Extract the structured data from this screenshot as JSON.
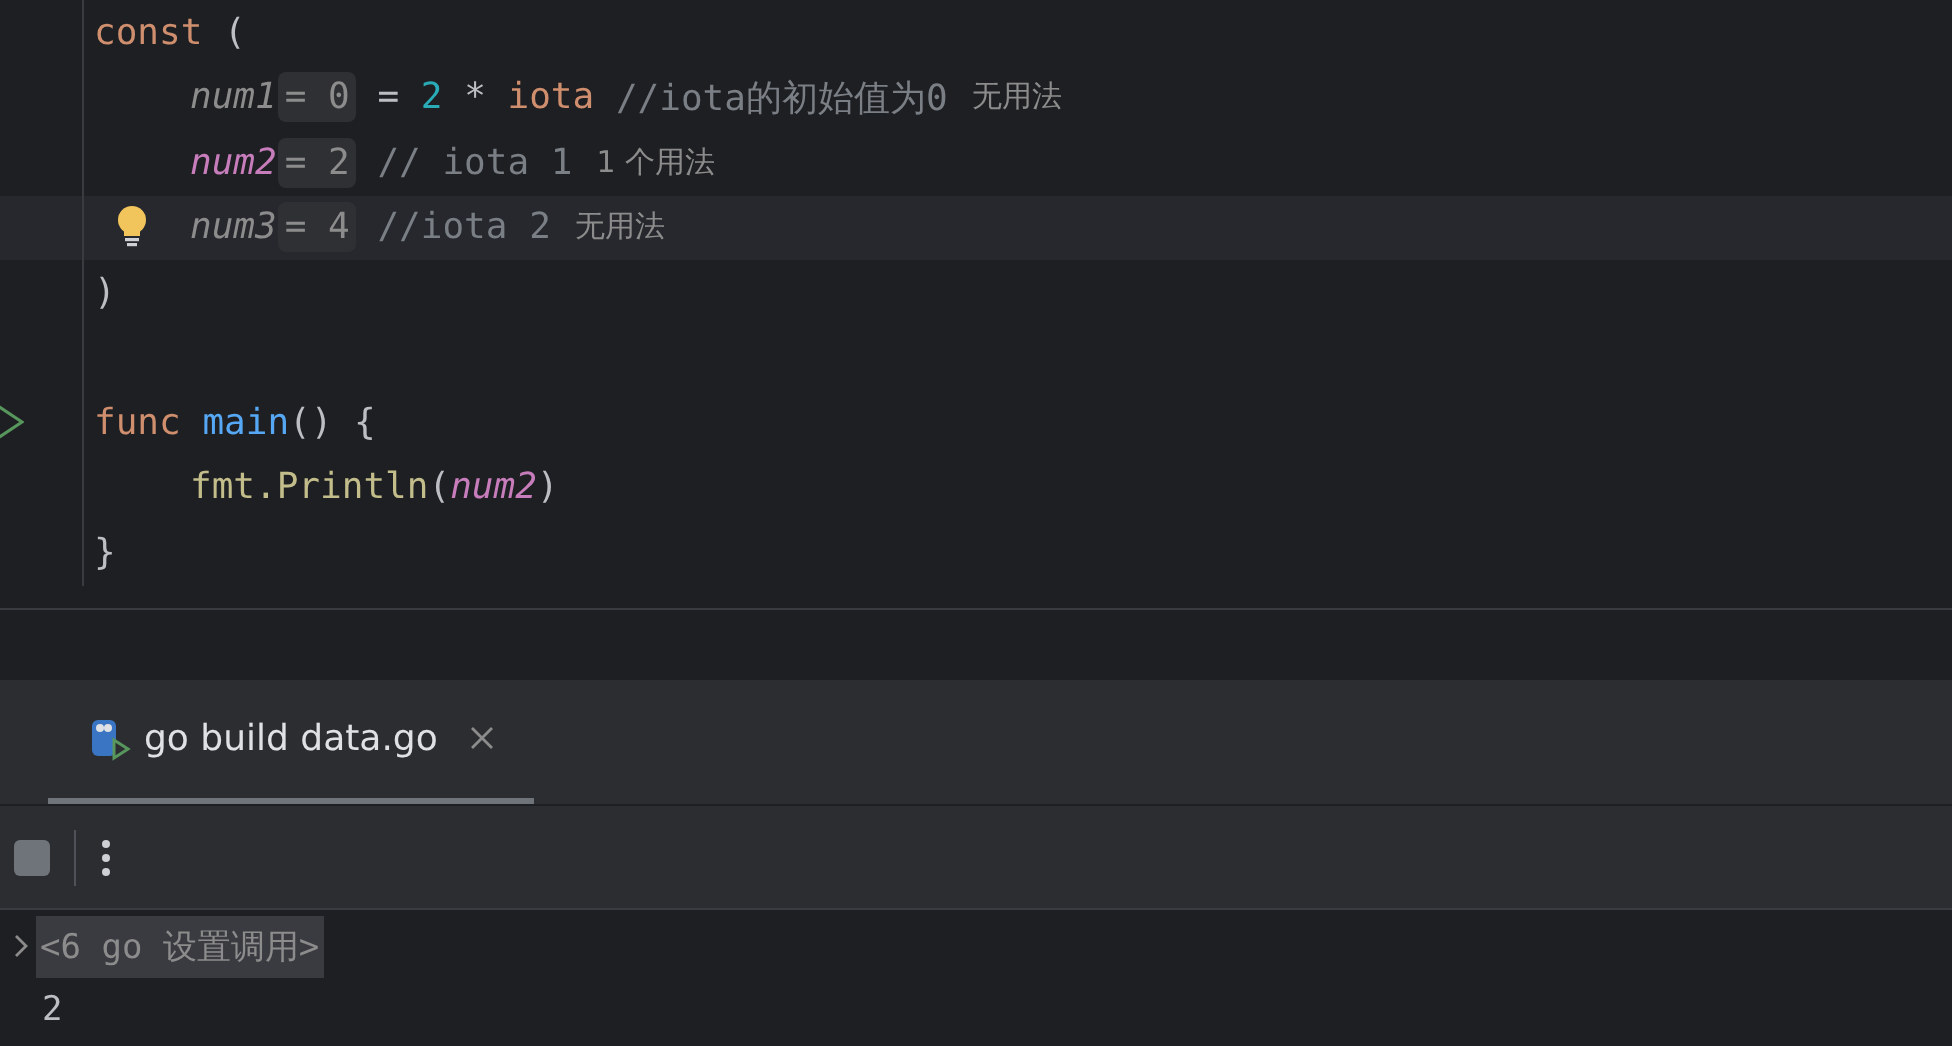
{
  "editor": {
    "lines": [
      {
        "kind": "code",
        "tokens": [
          {
            "kind": "keyword",
            "text": "const"
          },
          {
            "kind": "plain",
            "text": " ("
          }
        ],
        "children": [
          {
            "kind": "code",
            "tokens": [
              {
                "kind": "unused",
                "text": "num1"
              },
              {
                "kind": "inlay",
                "text": "= 0"
              },
              {
                "kind": "plain",
                "text": " = "
              },
              {
                "kind": "number",
                "text": "2"
              },
              {
                "kind": "plain",
                "text": " * "
              },
              {
                "kind": "keyword",
                "text": "iota"
              },
              {
                "kind": "comment",
                "text": " //iota的初始值为0"
              },
              {
                "kind": "usage",
                "text": "无用法"
              }
            ]
          },
          {
            "kind": "code",
            "tokens": [
              {
                "kind": "used",
                "text": "num2"
              },
              {
                "kind": "inlay",
                "text": "= 2"
              },
              {
                "kind": "comment",
                "text": " // iota 1"
              },
              {
                "kind": "usage",
                "text": "1 个用法"
              }
            ]
          },
          {
            "kind": "current_bulb",
            "tokens": [
              {
                "kind": "unused",
                "text": "num3"
              },
              {
                "kind": "inlay",
                "text": "= 4"
              },
              {
                "kind": "comment",
                "text": " //iota 2"
              },
              {
                "kind": "usage",
                "text": "无用法"
              }
            ]
          }
        ]
      },
      {
        "kind": "code",
        "tokens": [
          {
            "kind": "plain",
            "text": ")"
          }
        ]
      },
      {
        "kind": "blank"
      },
      {
        "kind": "run",
        "tokens": [
          {
            "kind": "keyword",
            "text": "func"
          },
          {
            "kind": "function",
            "text": " main"
          },
          {
            "kind": "plain",
            "text": "() {"
          }
        ],
        "children": [
          {
            "kind": "code",
            "tokens": [
              {
                "kind": "call",
                "text": "fmt.Println"
              },
              {
                "kind": "plain",
                "text": "("
              },
              {
                "kind": "used",
                "text": "num2"
              },
              {
                "kind": "plain",
                "text": ")"
              }
            ]
          }
        ]
      },
      {
        "kind": "code",
        "tokens": [
          {
            "kind": "plain",
            "text": "}"
          }
        ]
      }
    ]
  },
  "run_panel": {
    "tabs": [
      {
        "label": "go build data.go",
        "selected": true
      }
    ],
    "console": [
      {
        "kind": "command",
        "text": "<6 go 设置调用>"
      },
      {
        "kind": "output",
        "text": "2"
      }
    ]
  }
}
